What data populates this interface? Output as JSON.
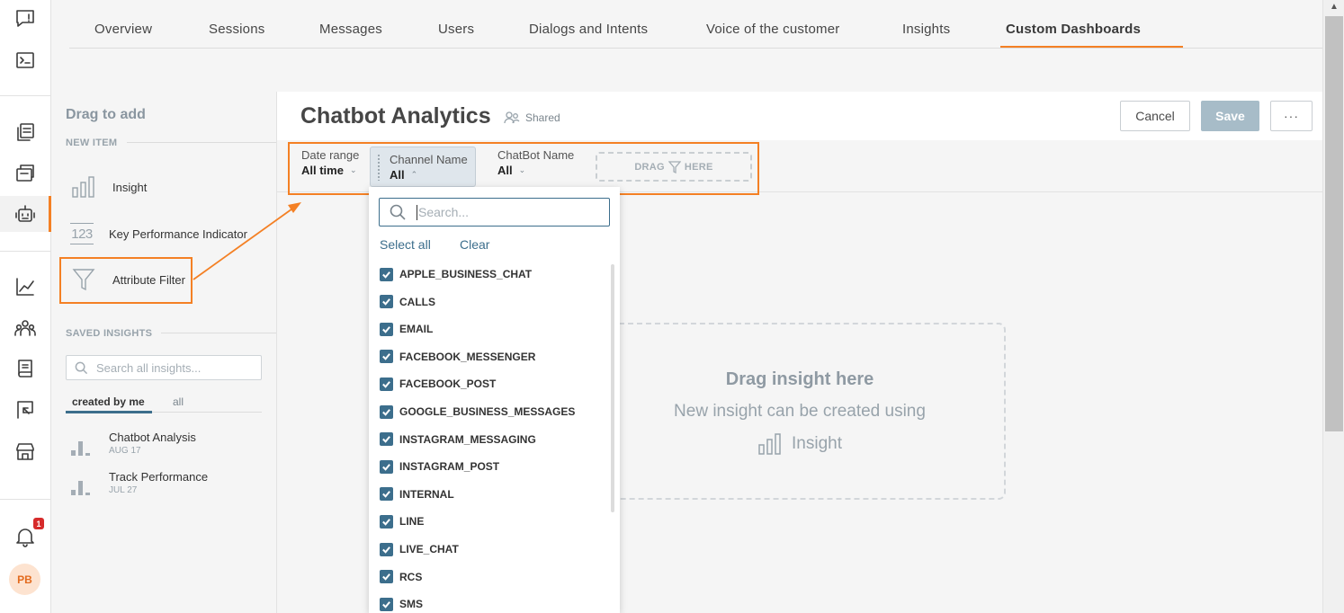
{
  "rail": {
    "icons": [
      "chat-icon",
      "terminal-icon",
      "copy-doc-icon",
      "stack-doc-icon",
      "bot-icon",
      "line-chart-icon",
      "people-icon",
      "book-icon",
      "flag-icon",
      "store-icon",
      "bell-icon"
    ],
    "notification_count": "1",
    "avatar_initials": "PB"
  },
  "tabs": [
    {
      "label": "Overview"
    },
    {
      "label": "Sessions"
    },
    {
      "label": "Messages"
    },
    {
      "label": "Users"
    },
    {
      "label": "Dialogs and Intents"
    },
    {
      "label": "Voice of the customer"
    },
    {
      "label": "Insights"
    },
    {
      "label": "Custom Dashboards",
      "active": true
    }
  ],
  "panel": {
    "heading": "Drag to add",
    "new_item_section": "NEW ITEM",
    "items": [
      {
        "label": "Insight",
        "icon": "bar-chart-icon"
      },
      {
        "label": "Key Performance Indicator",
        "icon": "kpi-123-icon"
      },
      {
        "label": "Attribute Filter",
        "icon": "funnel-icon"
      }
    ],
    "saved_section": "SAVED INSIGHTS",
    "search_placeholder": "Search all insights...",
    "filter_tabs": [
      "created by me",
      "all"
    ],
    "saved": [
      {
        "title": "Chatbot Analysis",
        "date": "AUG 17"
      },
      {
        "title": "Track Performance",
        "date": "JUL 27"
      }
    ]
  },
  "dashboard": {
    "title": "Chatbot Analytics",
    "shared_label": "Shared",
    "cancel": "Cancel",
    "save": "Save",
    "more": "···",
    "filters": [
      {
        "label": "Date range",
        "value": "All time"
      },
      {
        "label": "Channel Name",
        "value": "All"
      },
      {
        "label": "ChatBot Name",
        "value": "All"
      }
    ],
    "drag_here_left": "DRAG",
    "drag_here_right": "HERE",
    "dropzone": {
      "title": "Drag insight here",
      "line2": "New insight can be created using",
      "line3": "Insight"
    }
  },
  "dropdown": {
    "search_placeholder": "Search...",
    "select_all": "Select all",
    "clear": "Clear",
    "options": [
      "APPLE_BUSINESS_CHAT",
      "CALLS",
      "EMAIL",
      "FACEBOOK_MESSENGER",
      "FACEBOOK_POST",
      "GOOGLE_BUSINESS_MESSAGES",
      "INSTAGRAM_MESSAGING",
      "INSTAGRAM_POST",
      "INTERNAL",
      "LINE",
      "LIVE_CHAT",
      "RCS",
      "SMS"
    ]
  },
  "colors": {
    "accent": "#f48024",
    "primary": "#3c6e8c",
    "save_disabled": "#a7bcc8"
  }
}
